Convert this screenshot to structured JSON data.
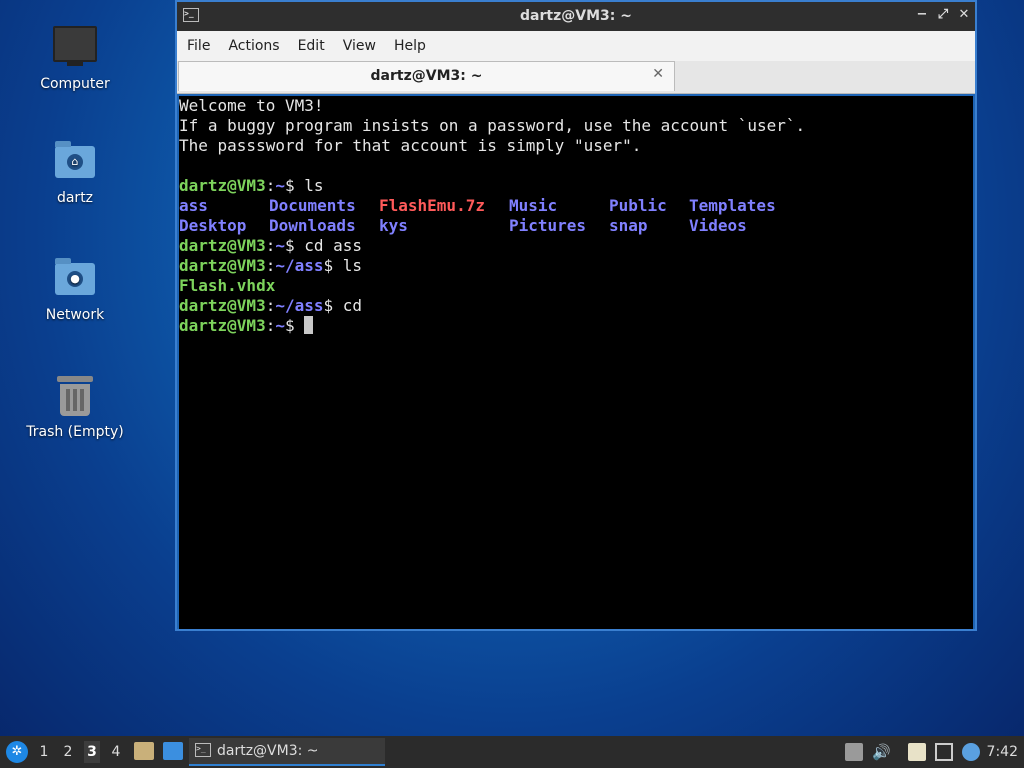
{
  "desktop": {
    "icons": [
      {
        "label": "Computer"
      },
      {
        "label": "dartz"
      },
      {
        "label": "Network"
      },
      {
        "label": "Trash (Empty)"
      }
    ]
  },
  "window": {
    "title": "dartz@VM3: ~",
    "controls": {
      "minimize": "−",
      "maximize": "⤢",
      "close": "✕"
    },
    "menu": [
      "File",
      "Actions",
      "Edit",
      "View",
      "Help"
    ],
    "tab": {
      "label": "dartz@VM3: ~",
      "close": "✕"
    }
  },
  "terminal": {
    "welcome": [
      "Welcome to VM3!",
      "If a buggy program insists on a password, use the account `user`.",
      "The passsword for that account is simply \"user\"."
    ],
    "prompt_user": "dartz@VM3",
    "cmd1": " ls",
    "ls_row1": [
      "ass",
      "Documents",
      "FlashEmu.7z",
      "Music",
      "Public",
      "Templates"
    ],
    "ls_row2": [
      "Desktop",
      "Downloads",
      "kys",
      "",
      "Pictures",
      "snap",
      "Videos"
    ],
    "cmd2": " cd ass",
    "cmd3": " ls",
    "ls_ass": "Flash.vhdx",
    "cmd4": " cd",
    "home_path": "~",
    "ass_path": "~/ass",
    "dollar": "$"
  },
  "taskbar": {
    "workspaces": [
      "1",
      "2",
      "3",
      "4"
    ],
    "active_workspace": "3",
    "task_label": "dartz@VM3: ~",
    "clock": "7:42"
  }
}
